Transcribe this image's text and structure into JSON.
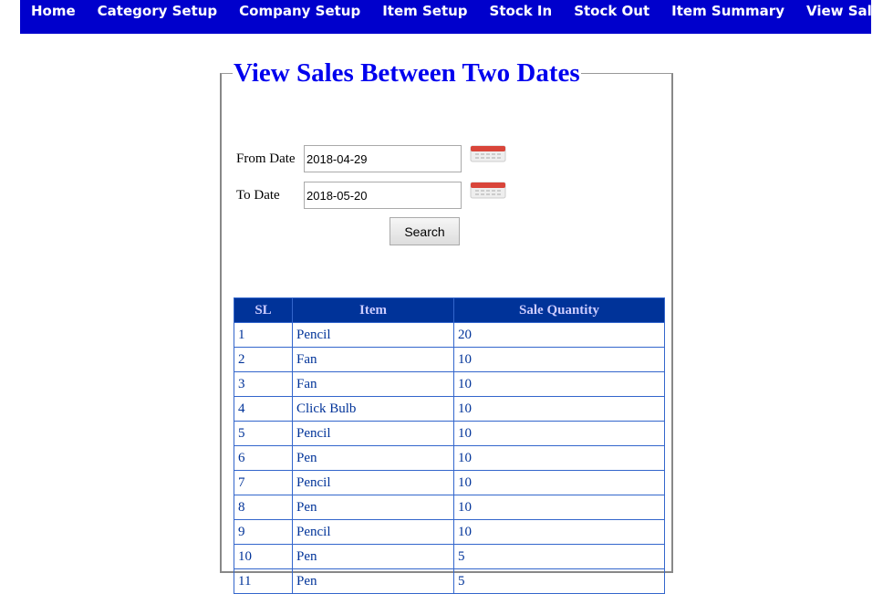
{
  "nav": [
    "Home",
    "Category Setup",
    "Company Setup",
    "Item Setup",
    "Stock In",
    "Stock Out",
    "Item Summary",
    "View Sales"
  ],
  "title": "View Sales Between Two Dates",
  "form": {
    "from_label": "From Date",
    "from_value": "2018-04-29",
    "to_label": "To Date",
    "to_value": "2018-05-20",
    "search_label": "Search",
    "calendar_icon": "calendar-icon"
  },
  "table": {
    "headers": [
      "SL",
      "Item",
      "Sale Quantity"
    ],
    "rows": [
      [
        "1",
        "Pencil",
        "20"
      ],
      [
        "2",
        "Fan",
        "10"
      ],
      [
        "3",
        "Fan",
        "10"
      ],
      [
        "4",
        "Click Bulb",
        "10"
      ],
      [
        "5",
        "Pencil",
        "10"
      ],
      [
        "6",
        "Pen",
        "10"
      ],
      [
        "7",
        "Pencil",
        "10"
      ],
      [
        "8",
        "Pen",
        "10"
      ],
      [
        "9",
        "Pencil",
        "10"
      ],
      [
        "10",
        "Pen",
        "5"
      ],
      [
        "11",
        "Pen",
        "5"
      ]
    ]
  },
  "colors": {
    "nav_bg": "#0000cc",
    "header_bg": "#003399",
    "header_text": "#ccccff",
    "title": "#0000ee"
  }
}
